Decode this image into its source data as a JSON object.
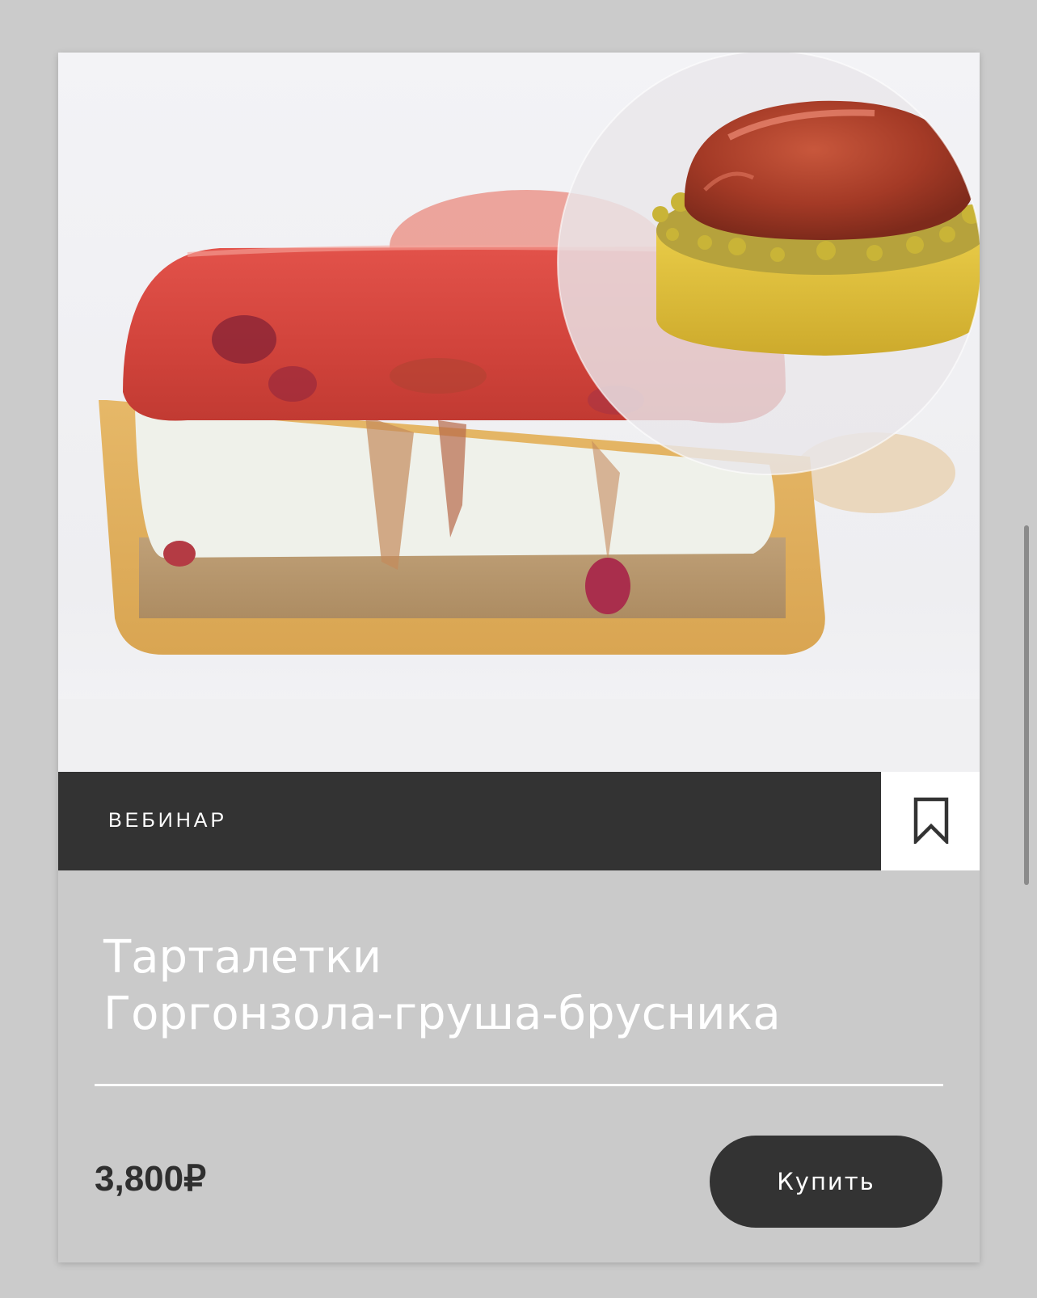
{
  "card": {
    "category_label": "ВЕБИНАР",
    "title_line1": "Тарталетки",
    "title_line2": "Горгонзола-груша-брусника",
    "price": "3,800₽",
    "buy_label": "Купить",
    "hero_image_alt": "Тарталетка в разрезе с начинкой из груши и брусники",
    "inset_image_alt": "Тарталетка целиком"
  },
  "icons": {
    "bookmark": "bookmark-icon"
  },
  "colors": {
    "page_bg": "#cbcbcb",
    "card_bg": "#cacaca",
    "dark": "#333333",
    "white": "#ffffff"
  }
}
